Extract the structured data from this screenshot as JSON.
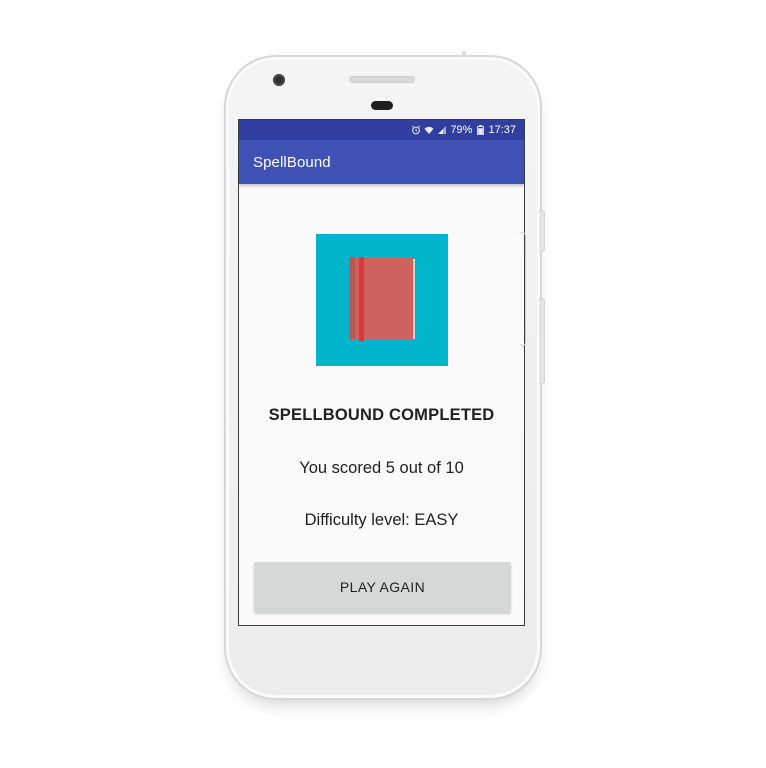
{
  "status_bar": {
    "battery": "79%",
    "time": "17:37",
    "icons": [
      "alarm-icon",
      "wifi-icon",
      "signal-icon",
      "battery-icon"
    ]
  },
  "app_bar": {
    "title": "SpellBound"
  },
  "result": {
    "heading": "SPELLBOUND COMPLETED",
    "score": "You scored 5 out of 10",
    "difficulty": "Difficulty level: EASY"
  },
  "actions": {
    "play_again_label": "PLAY AGAIN"
  },
  "colors": {
    "status_bar": "#303f9f",
    "app_bar": "#3f51b5",
    "book_tile_background": "#00b4cb",
    "book_cover": "#cd6261",
    "book_ribbon": "#e0353b",
    "button_background": "#d6d7d7"
  }
}
